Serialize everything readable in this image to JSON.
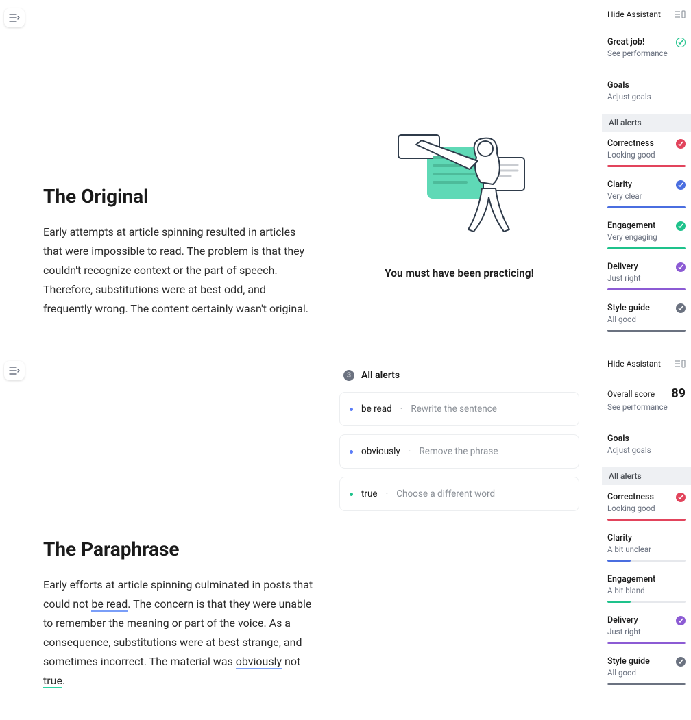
{
  "toggle_icon": "outline-toggle",
  "section1": {
    "title": "The Original",
    "body": "Early attempts at article spinning resulted in articles that were impossible to read. The problem is that they couldn't recognize context or the part of speech. Therefore, substitutions were at best odd, and frequently wrong. The content certainly wasn't original.",
    "praise": "You must have been practicing!"
  },
  "section2": {
    "title": "The Paraphrase",
    "body_parts": {
      "p0": "Early efforts at article spinning culminated in posts that could not ",
      "u1": "be read",
      "p1": ". The concern is that they were unable to remember the meaning or part of the voice. As a consequence, substitutions were at best strange, and sometimes incorrect. The material was ",
      "u2": "obviously",
      "p2": " not ",
      "u3": "true",
      "p3": "."
    },
    "alerts_header": "All alerts",
    "alerts_count": "3",
    "alerts": [
      {
        "dot": "blue",
        "word": "be read",
        "hint": "Rewrite the sentence"
      },
      {
        "dot": "blue",
        "word": "obviously",
        "hint": "Remove the phrase"
      },
      {
        "dot": "green",
        "word": "true",
        "hint": "Choose a different word"
      }
    ]
  },
  "sidebar1": {
    "hide": "Hide Assistant",
    "headline": "Great job!",
    "headline_sub": "See performance",
    "goals": "Goals",
    "goals_sub": "Adjust goals",
    "all_alerts": "All alerts",
    "cats": [
      {
        "name": "Correctness",
        "sub": "Looking good",
        "color": "red",
        "badge": true,
        "pct": 100
      },
      {
        "name": "Clarity",
        "sub": "Very clear",
        "color": "blue",
        "badge": true,
        "pct": 100
      },
      {
        "name": "Engagement",
        "sub": "Very engaging",
        "color": "green",
        "badge": true,
        "pct": 100
      },
      {
        "name": "Delivery",
        "sub": "Just right",
        "color": "purple",
        "badge": true,
        "pct": 100
      },
      {
        "name": "Style guide",
        "sub": "All good",
        "color": "grey",
        "badge": true,
        "pct": 100
      }
    ]
  },
  "sidebar2": {
    "hide": "Hide Assistant",
    "score_label": "Overall score",
    "score": "89",
    "score_sub": "See performance",
    "goals": "Goals",
    "goals_sub": "Adjust goals",
    "all_alerts": "All alerts",
    "cats": [
      {
        "name": "Correctness",
        "sub": "Looking good",
        "color": "red",
        "badge": true,
        "pct": 100
      },
      {
        "name": "Clarity",
        "sub": "A bit unclear",
        "color": "blue",
        "badge": false,
        "pct": 30
      },
      {
        "name": "Engagement",
        "sub": "A bit bland",
        "color": "green",
        "badge": false,
        "pct": 30
      },
      {
        "name": "Delivery",
        "sub": "Just right",
        "color": "purple",
        "badge": true,
        "pct": 100
      },
      {
        "name": "Style guide",
        "sub": "All good",
        "color": "grey",
        "badge": true,
        "pct": 100
      }
    ]
  },
  "colors": {
    "red": "#e2445c",
    "blue": "#4a6ee0",
    "green": "#1ec28b",
    "purple": "#8c5bd4",
    "grey": "#6b7280"
  }
}
